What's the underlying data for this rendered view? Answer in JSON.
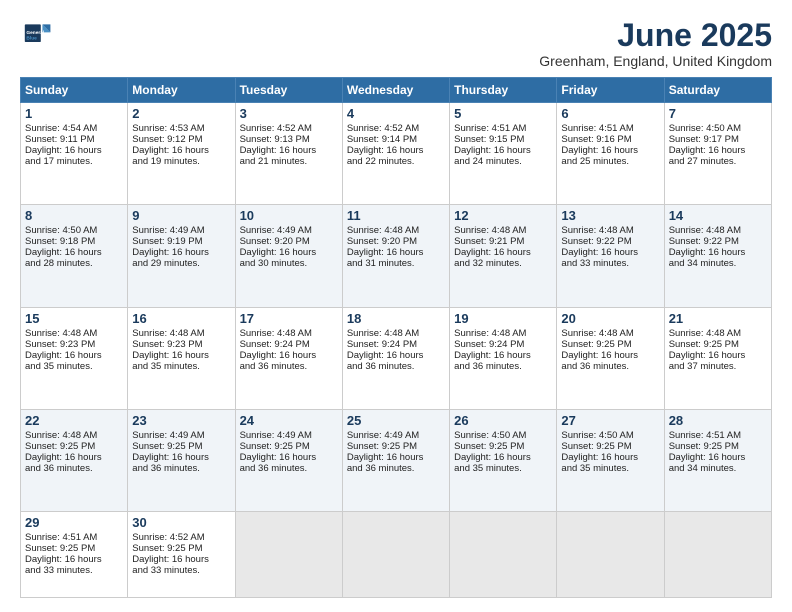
{
  "header": {
    "logo_line1": "General",
    "logo_line2": "Blue",
    "month_title": "June 2025",
    "location": "Greenham, England, United Kingdom"
  },
  "days_header": [
    "Sunday",
    "Monday",
    "Tuesday",
    "Wednesday",
    "Thursday",
    "Friday",
    "Saturday"
  ],
  "weeks": [
    [
      {
        "day": "1",
        "lines": [
          "Sunrise: 4:54 AM",
          "Sunset: 9:11 PM",
          "Daylight: 16 hours",
          "and 17 minutes."
        ]
      },
      {
        "day": "2",
        "lines": [
          "Sunrise: 4:53 AM",
          "Sunset: 9:12 PM",
          "Daylight: 16 hours",
          "and 19 minutes."
        ]
      },
      {
        "day": "3",
        "lines": [
          "Sunrise: 4:52 AM",
          "Sunset: 9:13 PM",
          "Daylight: 16 hours",
          "and 21 minutes."
        ]
      },
      {
        "day": "4",
        "lines": [
          "Sunrise: 4:52 AM",
          "Sunset: 9:14 PM",
          "Daylight: 16 hours",
          "and 22 minutes."
        ]
      },
      {
        "day": "5",
        "lines": [
          "Sunrise: 4:51 AM",
          "Sunset: 9:15 PM",
          "Daylight: 16 hours",
          "and 24 minutes."
        ]
      },
      {
        "day": "6",
        "lines": [
          "Sunrise: 4:51 AM",
          "Sunset: 9:16 PM",
          "Daylight: 16 hours",
          "and 25 minutes."
        ]
      },
      {
        "day": "7",
        "lines": [
          "Sunrise: 4:50 AM",
          "Sunset: 9:17 PM",
          "Daylight: 16 hours",
          "and 27 minutes."
        ]
      }
    ],
    [
      {
        "day": "8",
        "lines": [
          "Sunrise: 4:50 AM",
          "Sunset: 9:18 PM",
          "Daylight: 16 hours",
          "and 28 minutes."
        ]
      },
      {
        "day": "9",
        "lines": [
          "Sunrise: 4:49 AM",
          "Sunset: 9:19 PM",
          "Daylight: 16 hours",
          "and 29 minutes."
        ]
      },
      {
        "day": "10",
        "lines": [
          "Sunrise: 4:49 AM",
          "Sunset: 9:20 PM",
          "Daylight: 16 hours",
          "and 30 minutes."
        ]
      },
      {
        "day": "11",
        "lines": [
          "Sunrise: 4:48 AM",
          "Sunset: 9:20 PM",
          "Daylight: 16 hours",
          "and 31 minutes."
        ]
      },
      {
        "day": "12",
        "lines": [
          "Sunrise: 4:48 AM",
          "Sunset: 9:21 PM",
          "Daylight: 16 hours",
          "and 32 minutes."
        ]
      },
      {
        "day": "13",
        "lines": [
          "Sunrise: 4:48 AM",
          "Sunset: 9:22 PM",
          "Daylight: 16 hours",
          "and 33 minutes."
        ]
      },
      {
        "day": "14",
        "lines": [
          "Sunrise: 4:48 AM",
          "Sunset: 9:22 PM",
          "Daylight: 16 hours",
          "and 34 minutes."
        ]
      }
    ],
    [
      {
        "day": "15",
        "lines": [
          "Sunrise: 4:48 AM",
          "Sunset: 9:23 PM",
          "Daylight: 16 hours",
          "and 35 minutes."
        ]
      },
      {
        "day": "16",
        "lines": [
          "Sunrise: 4:48 AM",
          "Sunset: 9:23 PM",
          "Daylight: 16 hours",
          "and 35 minutes."
        ]
      },
      {
        "day": "17",
        "lines": [
          "Sunrise: 4:48 AM",
          "Sunset: 9:24 PM",
          "Daylight: 16 hours",
          "and 36 minutes."
        ]
      },
      {
        "day": "18",
        "lines": [
          "Sunrise: 4:48 AM",
          "Sunset: 9:24 PM",
          "Daylight: 16 hours",
          "and 36 minutes."
        ]
      },
      {
        "day": "19",
        "lines": [
          "Sunrise: 4:48 AM",
          "Sunset: 9:24 PM",
          "Daylight: 16 hours",
          "and 36 minutes."
        ]
      },
      {
        "day": "20",
        "lines": [
          "Sunrise: 4:48 AM",
          "Sunset: 9:25 PM",
          "Daylight: 16 hours",
          "and 36 minutes."
        ]
      },
      {
        "day": "21",
        "lines": [
          "Sunrise: 4:48 AM",
          "Sunset: 9:25 PM",
          "Daylight: 16 hours",
          "and 37 minutes."
        ]
      }
    ],
    [
      {
        "day": "22",
        "lines": [
          "Sunrise: 4:48 AM",
          "Sunset: 9:25 PM",
          "Daylight: 16 hours",
          "and 36 minutes."
        ]
      },
      {
        "day": "23",
        "lines": [
          "Sunrise: 4:49 AM",
          "Sunset: 9:25 PM",
          "Daylight: 16 hours",
          "and 36 minutes."
        ]
      },
      {
        "day": "24",
        "lines": [
          "Sunrise: 4:49 AM",
          "Sunset: 9:25 PM",
          "Daylight: 16 hours",
          "and 36 minutes."
        ]
      },
      {
        "day": "25",
        "lines": [
          "Sunrise: 4:49 AM",
          "Sunset: 9:25 PM",
          "Daylight: 16 hours",
          "and 36 minutes."
        ]
      },
      {
        "day": "26",
        "lines": [
          "Sunrise: 4:50 AM",
          "Sunset: 9:25 PM",
          "Daylight: 16 hours",
          "and 35 minutes."
        ]
      },
      {
        "day": "27",
        "lines": [
          "Sunrise: 4:50 AM",
          "Sunset: 9:25 PM",
          "Daylight: 16 hours",
          "and 35 minutes."
        ]
      },
      {
        "day": "28",
        "lines": [
          "Sunrise: 4:51 AM",
          "Sunset: 9:25 PM",
          "Daylight: 16 hours",
          "and 34 minutes."
        ]
      }
    ],
    [
      {
        "day": "29",
        "lines": [
          "Sunrise: 4:51 AM",
          "Sunset: 9:25 PM",
          "Daylight: 16 hours",
          "and 33 minutes."
        ]
      },
      {
        "day": "30",
        "lines": [
          "Sunrise: 4:52 AM",
          "Sunset: 9:25 PM",
          "Daylight: 16 hours",
          "and 33 minutes."
        ]
      },
      {
        "day": "",
        "lines": []
      },
      {
        "day": "",
        "lines": []
      },
      {
        "day": "",
        "lines": []
      },
      {
        "day": "",
        "lines": []
      },
      {
        "day": "",
        "lines": []
      }
    ]
  ]
}
